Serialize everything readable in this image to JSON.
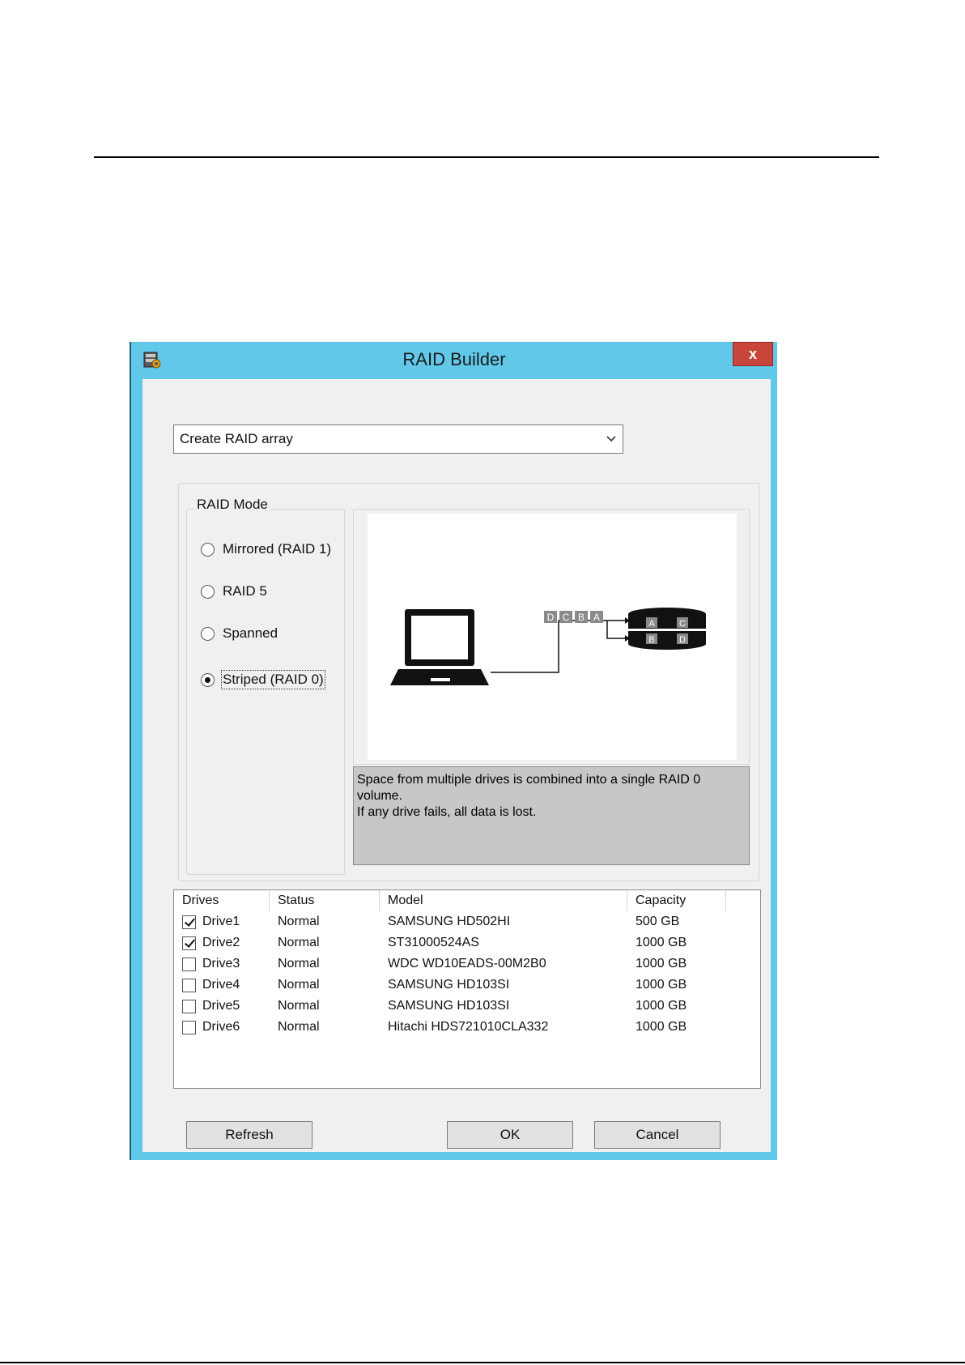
{
  "window": {
    "title": "RAID Builder",
    "close_label": "x"
  },
  "operation_select": {
    "value": "Create RAID array"
  },
  "raid_mode": {
    "legend": "RAID Mode",
    "options": [
      {
        "label": "Mirrored (RAID 1)",
        "selected": false
      },
      {
        "label": "RAID 5",
        "selected": false
      },
      {
        "label": "Spanned",
        "selected": false
      },
      {
        "label": "Striped (RAID 0)",
        "selected": true
      }
    ]
  },
  "diagram": {
    "stream_blocks": [
      "D",
      "C",
      "B",
      "A"
    ],
    "disk_top": [
      "A",
      "C"
    ],
    "disk_bottom": [
      "B",
      "D"
    ]
  },
  "description": {
    "line1": "Space from multiple drives is combined into a single RAID 0 volume.",
    "line2": "If any drive fails, all data is lost."
  },
  "drives_table": {
    "headers": {
      "drives": "Drives",
      "status": "Status",
      "model": "Model",
      "capacity": "Capacity"
    },
    "rows": [
      {
        "name": "Drive1",
        "checked": true,
        "status": "Normal",
        "model": "SAMSUNG HD502HI",
        "capacity": "500 GB"
      },
      {
        "name": "Drive2",
        "checked": true,
        "status": "Normal",
        "model": "ST31000524AS",
        "capacity": "1000 GB"
      },
      {
        "name": "Drive3",
        "checked": false,
        "status": "Normal",
        "model": "WDC WD10EADS-00M2B0",
        "capacity": "1000 GB"
      },
      {
        "name": "Drive4",
        "checked": false,
        "status": "Normal",
        "model": "SAMSUNG HD103SI",
        "capacity": "1000 GB"
      },
      {
        "name": "Drive5",
        "checked": false,
        "status": "Normal",
        "model": "SAMSUNG HD103SI",
        "capacity": "1000 GB"
      },
      {
        "name": "Drive6",
        "checked": false,
        "status": "Normal",
        "model": "Hitachi HDS721010CLA332",
        "capacity": "1000 GB"
      }
    ]
  },
  "buttons": {
    "refresh": "Refresh",
    "ok": "OK",
    "cancel": "Cancel"
  },
  "colors": {
    "window_frame": "#62c8ea",
    "close_button": "#c9453c",
    "description_bg": "#c7c7c7"
  }
}
